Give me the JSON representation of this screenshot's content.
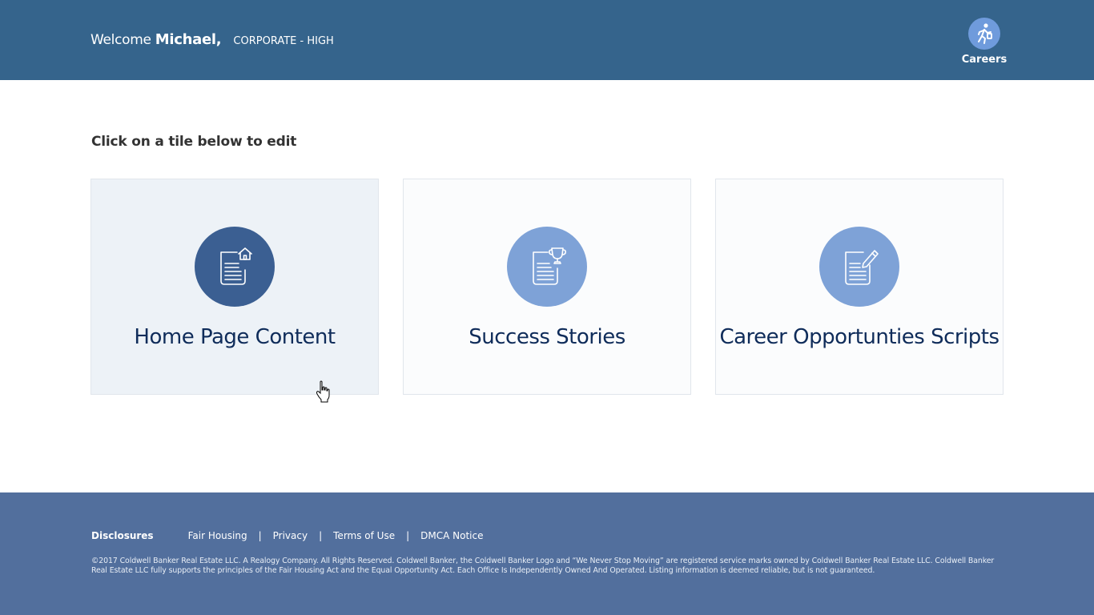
{
  "header": {
    "welcome_prefix": "Welcome",
    "user_name": "Michael,",
    "role": "CORPORATE - HIGH",
    "careers_label": "Careers",
    "careers_icon": "running-person-icon"
  },
  "main": {
    "instruction": "Click on a tile below to edit",
    "tiles": [
      {
        "title": "Home Page Content",
        "icon": "document-home-icon"
      },
      {
        "title": "Success Stories",
        "icon": "document-trophy-icon"
      },
      {
        "title": "Career Opportunties Scripts",
        "icon": "document-edit-icon"
      }
    ]
  },
  "footer": {
    "disclosures": "Disclosures",
    "links": [
      "Fair Housing",
      "Privacy",
      "Terms of Use",
      "DMCA Notice"
    ],
    "separator": "|",
    "copyright": "©2017 Coldwell Banker Real Estate LLC. A Realogy Company. All Rights Reserved. Coldwell Banker, the Coldwell Banker Logo and “We Never Stop Moving” are registered service marks owned by Coldwell Banker Real Estate LLC. Coldwell Banker Real Estate LLC fully supports the principles of the Fair Housing Act and the Equal Opportunity Act. Each Office Is Independently Owned And Operated. Listing information is deemed reliable, but is not guaranteed."
  },
  "colors": {
    "header_bg": "#35648c",
    "footer_bg": "#526f9d",
    "tile_icon_active": "#3b5f92",
    "tile_icon": "#7ea2d7",
    "tile_title": "#0f2c5a"
  }
}
